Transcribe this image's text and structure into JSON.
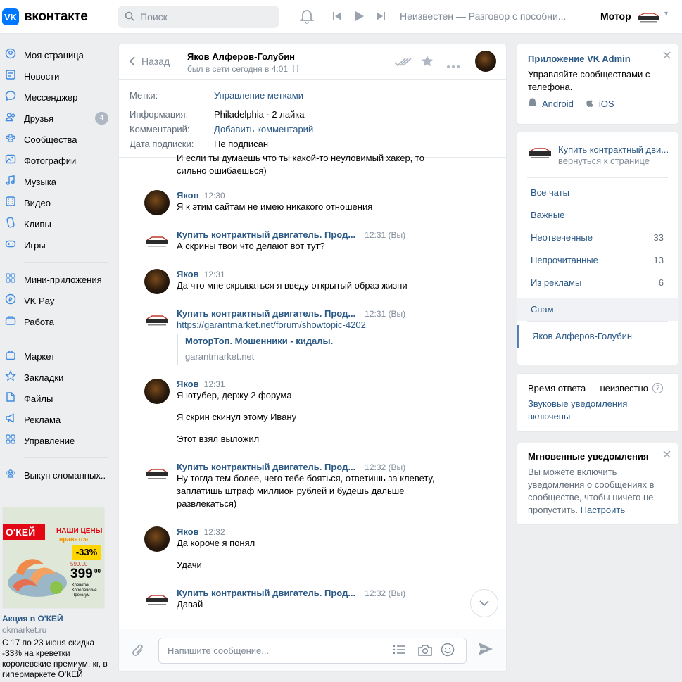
{
  "header": {
    "logo_text": "вконтакте",
    "logo_mark": "VK",
    "search_placeholder": "Поиск",
    "player_track": "Неизвестен — Разговор с пособни...",
    "user_name": "Мотор",
    "icons": [
      "search-icon",
      "bell-icon",
      "prev-icon",
      "play-icon",
      "next-icon",
      "chevron-down-icon"
    ]
  },
  "nav": {
    "group1": [
      {
        "label": "Моя страница",
        "icon": "user-icon"
      },
      {
        "label": "Новости",
        "icon": "news-icon"
      },
      {
        "label": "Мессенджер",
        "icon": "message-icon"
      },
      {
        "label": "Друзья",
        "icon": "friends-icon",
        "count": "4"
      },
      {
        "label": "Сообщества",
        "icon": "communities-icon"
      },
      {
        "label": "Фотографии",
        "icon": "photo-icon"
      },
      {
        "label": "Музыка",
        "icon": "music-icon"
      },
      {
        "label": "Видео",
        "icon": "video-icon"
      },
      {
        "label": "Клипы",
        "icon": "clips-icon"
      },
      {
        "label": "Игры",
        "icon": "games-icon"
      }
    ],
    "group2": [
      {
        "label": "Мини-приложения",
        "icon": "apps-icon"
      },
      {
        "label": "VK Pay",
        "icon": "vkpay-icon"
      },
      {
        "label": "Работа",
        "icon": "work-icon"
      }
    ],
    "group3": [
      {
        "label": "Маркет",
        "icon": "market-icon"
      },
      {
        "label": "Закладки",
        "icon": "bookmark-icon"
      },
      {
        "label": "Файлы",
        "icon": "files-icon"
      },
      {
        "label": "Реклама",
        "icon": "ads-icon"
      },
      {
        "label": "Управление",
        "icon": "manage-icon"
      }
    ],
    "group4": [
      {
        "label": "Выкуп сломанных..",
        "icon": "community-icon"
      }
    ]
  },
  "ad": {
    "brand": "О'КЕЙ",
    "headline_1": "НАШИ ЦЕНЫ",
    "headline_2": "нравятся",
    "discount": "-33%",
    "old_price": "599.00",
    "new_price": "399",
    "new_price_kop": "00",
    "product": "Креветки Королевские Премиум",
    "title": "Акция в О'КЕЙ",
    "domain": "okmarket.ru",
    "text": "С 17 по 23 июня скидка -33% на креветки королевские премиум, кг, в гипермаркете О'КЕЙ"
  },
  "chat": {
    "back_label": "Назад",
    "name": "Яков Алферов-Голубин",
    "status": "был в сети сегодня в 4:01",
    "info": {
      "labels_key": "Метки:",
      "labels_val": "Управление метками",
      "info_key": "Информация:",
      "info_val": "Philadelphia · 2 лайка",
      "comment_key": "Комментарий:",
      "comment_val": "Добавить комментарий",
      "sub_key": "Дата подписки:",
      "sub_val": "Не подписан"
    },
    "messages": {
      "m0_line1": "И если ты думаешь что ты какой-то неуловимый хакер, то",
      "m0_line2": "сильно ошибаешься)",
      "m1_author": "Яков",
      "m1_time": "12:30",
      "m1_text": "Я к этим сайтам не имею никакого отношения",
      "m2_author": "Купить контрактный двигатель. Прод...",
      "m2_time": "12:31 (Вы)",
      "m2_text": "А скрины твои что делают вот тут?",
      "m3_author": "Яков",
      "m3_time": "12:31",
      "m3_text": "Да что мне скрываться я введу открытый образ жизни",
      "m4_author": "Купить контрактный двигатель. Прод...",
      "m4_time": "12:31 (Вы)",
      "m4_link": "https://garantmarket.net/forum/showtopic-4202",
      "m4_card_title": "МоторТоп. Мошенники - кидалы.",
      "m4_card_domain": "garantmarket.net",
      "m5_author": "Яков",
      "m5_time": "12:31",
      "m5_text1": "Я ютубер, держу 2 форума",
      "m5_text2": "Я скрин скинул этому Ивану",
      "m5_text3": "Этот взял выложил",
      "m6_author": "Купить контрактный двигатель. Прод...",
      "m6_time": "12:32 (Вы)",
      "m6_line1": "Ну тогда тем более, чего тебе бояться, ответишь за клевету,",
      "m6_line2": "заплатишь штраф миллион рублей и будешь дальше",
      "m6_line3": "развлекаться)",
      "m7_author": "Яков",
      "m7_time": "12:32",
      "m7_text1": "Да короче я понял",
      "m7_text2": "Удачи",
      "m8_author": "Купить контрактный двигатель. Прод...",
      "m8_time": "12:32 (Вы)",
      "m8_text": "Давай"
    },
    "composer_placeholder": "Напишите сообщение..."
  },
  "right": {
    "app_card": {
      "title": "Приложение VK Admin",
      "text": "Управляйте сообществами с телефона.",
      "android": "Android",
      "ios": "iOS"
    },
    "community": {
      "name": "Купить контрактный дви...",
      "back": "вернуться к странице"
    },
    "filters": [
      {
        "label": "Все чаты",
        "count": ""
      },
      {
        "label": "Важные",
        "count": ""
      },
      {
        "label": "Неотвеченные",
        "count": "33"
      },
      {
        "label": "Непрочитанные",
        "count": "13"
      },
      {
        "label": "Из рекламы",
        "count": "6"
      }
    ],
    "spam": "Спам",
    "active_chat": "Яков Алферов-Голубин",
    "response": {
      "text": "Время ответа — неизвестно",
      "help": "?",
      "sound": "Звуковые уведомления включены"
    },
    "instant": {
      "title": "Мгновенные уведомления",
      "text": "Вы можете включить уведомления о сообщениях в сообществе, чтобы ничего не пропустить.",
      "link": "Настроить"
    }
  }
}
